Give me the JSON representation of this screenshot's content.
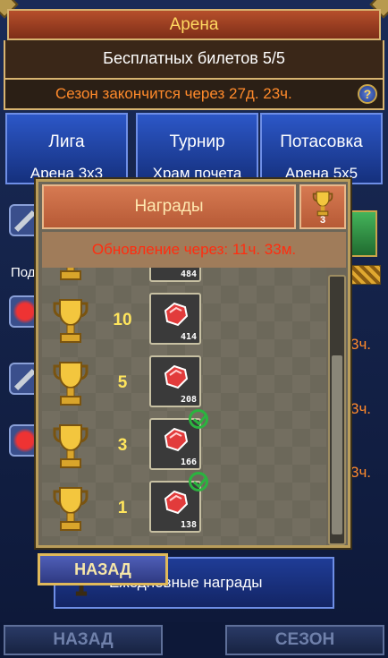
{
  "header": {
    "title": "Арена",
    "tickets": "Бесплатных билетов 5/5",
    "season": "Сезон закончится через 27д. 23ч."
  },
  "tabs": [
    {
      "name": "Лига",
      "sub": "Арена 3х3"
    },
    {
      "name": "Турнир",
      "sub": "Храм почета"
    },
    {
      "name": "Потасовка",
      "sub": "Арена 5х5"
    }
  ],
  "side": {
    "label": "Под",
    "times": [
      "3ч.",
      "3ч.",
      "3ч."
    ]
  },
  "modal": {
    "title": "Награды",
    "trophy_count": "3",
    "update": "Обновление через: 11ч. 33м.",
    "rows": [
      {
        "rank": "",
        "gems": "484",
        "claimed": false
      },
      {
        "rank": "10",
        "gems": "414",
        "claimed": false
      },
      {
        "rank": "5",
        "gems": "208",
        "claimed": false
      },
      {
        "rank": "3",
        "gems": "166",
        "claimed": true
      },
      {
        "rank": "1",
        "gems": "138",
        "claimed": true
      }
    ],
    "back": "НАЗАД"
  },
  "banner": {
    "label": "Ежедневные награды"
  },
  "bottom": {
    "back": "НАЗАД",
    "season": "СЕЗОН"
  },
  "colors": {
    "accent_orange": "#ff8a2b",
    "update_red": "#ff2d10",
    "rank_yellow": "#ffe55c"
  }
}
